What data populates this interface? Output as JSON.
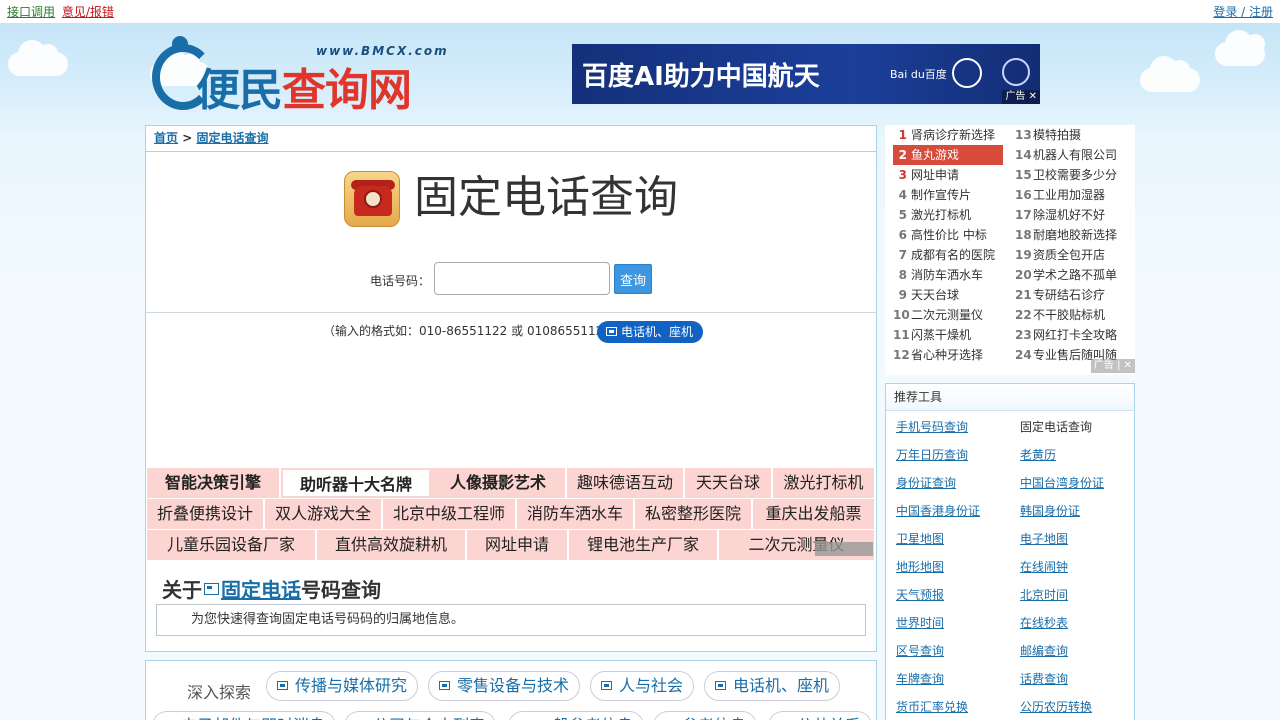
{
  "topbar": {
    "api_link": "接口调用",
    "report_link": "意见/报错",
    "login_link": "登录 / 注册"
  },
  "logo": {
    "brand_part1": "便民",
    "brand_part2": "查询网",
    "url": "www.BMCX.com"
  },
  "banner": {
    "text": "百度AI助力中国航天",
    "sub": "Bai du百度",
    "ad_label": "广告"
  },
  "breadcrumb": {
    "home": "首页",
    "current": "固定电话查询",
    "separator": ">"
  },
  "page": {
    "title": "固定电话查询",
    "field_label": "电话号码：",
    "input_value": "",
    "input_placeholder": "",
    "search_button": "查询",
    "hint": "（输入的格式如：010-86551122 或 01086551122）",
    "hint_tag": "电话机、座机"
  },
  "keywords": {
    "rows": [
      [
        {
          "label": "智能决策引擎",
          "w": 134,
          "bold": true
        },
        {
          "label": "助听器十大名牌",
          "w": 150,
          "bold": true,
          "sel": true
        },
        {
          "label": "人像摄影艺术",
          "w": 136,
          "bold": true
        },
        {
          "label": "趣味德语互动",
          "w": 118
        },
        {
          "label": "天天台球",
          "w": 88
        },
        {
          "label": "激光打标机",
          "w": 103
        }
      ],
      [
        {
          "label": "折叠便携设计",
          "w": 118
        },
        {
          "label": "双人游戏大全",
          "w": 118
        },
        {
          "label": "北京中级工程师",
          "w": 134
        },
        {
          "label": "消防车洒水车",
          "w": 118
        },
        {
          "label": "私密整形医院",
          "w": 118
        },
        {
          "label": "重庆出发船票",
          "w": 123
        }
      ],
      [
        {
          "label": "儿童乐园设备厂家",
          "w": 170
        },
        {
          "label": "直供高效旋耕机",
          "w": 150
        },
        {
          "label": "网址申请",
          "w": 102
        },
        {
          "label": "锂电池生产厂家",
          "w": 150
        },
        {
          "label": "二次元测量仪",
          "w": 157
        }
      ]
    ]
  },
  "about": {
    "prefix": "关于",
    "highlight": "固定电话",
    "suffix": "号码查询",
    "description": "为您快速得查询固定电话号码码的归属地信息。"
  },
  "explore": {
    "label": "深入探索",
    "tags_row1": [
      "传播与媒体研究",
      "零售设备与技术",
      "人与社会",
      "电话机、座机"
    ],
    "tags_row2": [
      "电子邮件与即时消息",
      "公司与个人列表",
      "一般参考信息",
      "参考信息",
      "公共关系"
    ]
  },
  "ranking": {
    "left": [
      {
        "n": "1",
        "label": "肾病诊疗新选择"
      },
      {
        "n": "2",
        "label": "鱼丸游戏"
      },
      {
        "n": "3",
        "label": "网址申请"
      },
      {
        "n": "4",
        "label": "制作宣传片"
      },
      {
        "n": "5",
        "label": "激光打标机"
      },
      {
        "n": "6",
        "label": "高性价比 中标"
      },
      {
        "n": "7",
        "label": "成都有名的医院"
      },
      {
        "n": "8",
        "label": "消防车洒水车"
      },
      {
        "n": "9",
        "label": "天天台球"
      },
      {
        "n": "10",
        "label": "二次元测量仪"
      },
      {
        "n": "11",
        "label": "闪蒸干燥机"
      },
      {
        "n": "12",
        "label": "省心种牙选择"
      }
    ],
    "right": [
      {
        "n": "13",
        "label": "模特拍摄"
      },
      {
        "n": "14",
        "label": "机器人有限公司"
      },
      {
        "n": "15",
        "label": "卫校需要多少分"
      },
      {
        "n": "16",
        "label": "工业用加湿器"
      },
      {
        "n": "17",
        "label": "除湿机好不好"
      },
      {
        "n": "18",
        "label": "耐磨地胶新选择"
      },
      {
        "n": "19",
        "label": "资质全包开店"
      },
      {
        "n": "20",
        "label": "学术之路不孤单"
      },
      {
        "n": "21",
        "label": "专研结石诊疗"
      },
      {
        "n": "22",
        "label": "不干胶贴标机"
      },
      {
        "n": "23",
        "label": "网红打卡全攻略"
      },
      {
        "n": "24",
        "label": "专业售后随叫随"
      }
    ],
    "ad_label": "广告"
  },
  "tools": {
    "heading": "推荐工具",
    "items": [
      [
        "手机号码查询",
        "固定电话查询"
      ],
      [
        "万年日历查询",
        "老黄历"
      ],
      [
        "身份证查询",
        "中国台湾身份证"
      ],
      [
        "中国香港身份证",
        "韩国身份证"
      ],
      [
        "卫星地图",
        "电子地图"
      ],
      [
        "地形地图",
        "在线闹钟"
      ],
      [
        "天气预报",
        "北京时间"
      ],
      [
        "世界时间",
        "在线秒表"
      ],
      [
        "区号查询",
        "邮编查询"
      ],
      [
        "车牌查询",
        "话费查询"
      ],
      [
        "货币汇率兑换",
        "公历农历转换"
      ]
    ],
    "current": "固定电话查询"
  },
  "colors": {
    "accent": "#1a6ea8",
    "red": "#e0352b",
    "keyword_bg": "#fcd4d1",
    "button": "#3c96e0"
  }
}
